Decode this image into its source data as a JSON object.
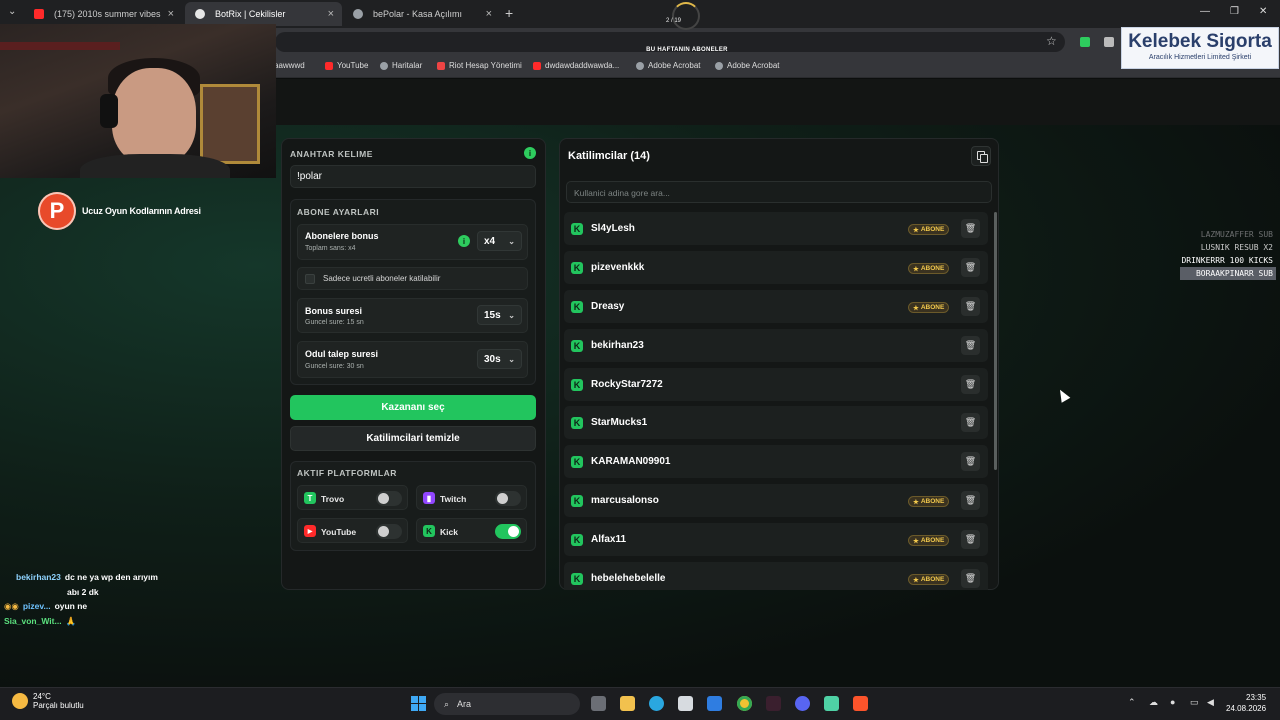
{
  "browser": {
    "tabs": [
      {
        "label": "(175) 2010s summer vibes",
        "active": false
      },
      {
        "label": "BotRix | Cekilisler",
        "active": true
      },
      {
        "label": "bePolar - Kasa Açılımı",
        "active": false
      }
    ],
    "bookmarks": [
      "aawwwd",
      "YouTube",
      "Haritalar",
      "Riot Hesap Yönetimi",
      "dwdawdaddwawda...",
      "Adobe Acrobat",
      "Adobe Acrobat"
    ]
  },
  "overlay": {
    "top_banner": "BU HAFTANIN ABONELER",
    "counter": "2 / 19",
    "sponsor_title": "Kelebek Sigorta",
    "sponsor_sub": "Aracılık Hizmetleri Limited Şirketi",
    "promo_text": "Ucuz Oyun Kodlarının Adresi",
    "events": [
      "LAZMUZAFFER SUB",
      "LUSNIK RESUB X2",
      "DRINKERRR 100 KICKS",
      "BORAAKPINARR SUB"
    ],
    "chat": [
      {
        "user": "bekirhan23",
        "lines": [
          "dc ne ya wp den arıyım",
          "abı 2 dk"
        ]
      },
      {
        "user": "pizev...",
        "lines": [
          "oyun ne"
        ]
      },
      {
        "user": "Sia_von_Wit...",
        "lines": [
          "🙏"
        ]
      }
    ]
  },
  "settings": {
    "keyword_label": "ANAHTAR KELIME",
    "keyword_value": "!polar",
    "sub_section_label": "ABONE AYARLARI",
    "sub_bonus_title": "Abonelere bonus",
    "sub_bonus_sub": "Toplam sans: x4",
    "sub_bonus_value": "x4",
    "only_paid_label": "Sadece ucretli aboneler katilabilir",
    "bonus_time_title": "Bonus suresi",
    "bonus_time_sub": "Guncel sure: 15 sn",
    "bonus_time_value": "15s",
    "claim_time_title": "Odul talep suresi",
    "claim_time_sub": "Guncel sure: 30 sn",
    "claim_time_value": "30s",
    "pick_winner": "Kazananı seç",
    "clear_participants": "Katilimcilari temizle",
    "platforms_label": "AKTIF PLATFORMLAR",
    "platforms": [
      {
        "name": "Trovo",
        "enabled": false,
        "color": "#22c55e",
        "glyph": "T"
      },
      {
        "name": "Twitch",
        "enabled": false,
        "color": "#9146ff",
        "glyph": "▮"
      },
      {
        "name": "YouTube",
        "enabled": false,
        "color": "#ff2a2a",
        "glyph": "▶"
      },
      {
        "name": "Kick",
        "enabled": true,
        "color": "#22c55e",
        "glyph": "K"
      }
    ]
  },
  "participants": {
    "title": "Katilimcilar (14)",
    "search_placeholder": "Kullanici adina gore ara...",
    "badge_label": "ABONE",
    "rows": [
      {
        "name": "Sl4yLesh",
        "sub": true
      },
      {
        "name": "pizevenkkk",
        "sub": true
      },
      {
        "name": "Dreasy",
        "sub": true
      },
      {
        "name": "bekirhan23",
        "sub": false
      },
      {
        "name": "RockyStar7272",
        "sub": false
      },
      {
        "name": "StarMucks1",
        "sub": false
      },
      {
        "name": "KARAMAN09901",
        "sub": false
      },
      {
        "name": "marcusalonso",
        "sub": true
      },
      {
        "name": "Alfax11",
        "sub": true
      },
      {
        "name": "hebelehebelelle",
        "sub": true
      }
    ]
  },
  "taskbar": {
    "temp": "24°C",
    "weather": "Parçalı bulutlu",
    "search": "Ara",
    "time": "23:35",
    "date": "24.08.2026"
  },
  "colors": {
    "accent": "#22c55e",
    "badge": "#f2c94c"
  }
}
